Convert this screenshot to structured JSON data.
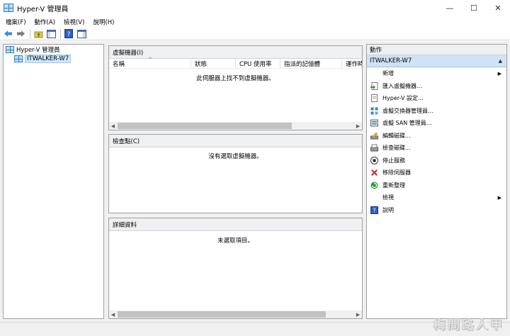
{
  "window": {
    "title": "Hyper-V 管理員",
    "minimize": "—",
    "maximize": "☐",
    "close": "✕"
  },
  "menu": [
    "檔案(F)",
    "動作(A)",
    "檢視(V)",
    "說明(H)"
  ],
  "tree": {
    "root": "Hyper-V 管理員",
    "server": "ITWALKER-W7"
  },
  "vm_panel": {
    "title": "虛擬機器(I)",
    "columns": [
      "名稱",
      "狀態",
      "CPU 使用率",
      "指派的記憶體",
      "運作時"
    ],
    "empty_message": "此伺服器上找不到虛擬機器。"
  },
  "checkpoint_panel": {
    "title": "檢查點(C)",
    "empty_message": "沒有選取虛擬機器。"
  },
  "details_panel": {
    "title": "詳細資料",
    "empty_message": "未選取項目。"
  },
  "actions": {
    "header": "動作",
    "section": "ITWALKER-W7",
    "items": [
      {
        "label": "新增",
        "icon": "none",
        "submenu": true
      },
      {
        "label": "匯入虛擬機器...",
        "icon": "import-icon"
      },
      {
        "label": "Hyper-V 設定...",
        "icon": "settings-page-icon"
      },
      {
        "label": "虛擬交換器管理員...",
        "icon": "switch-icon"
      },
      {
        "label": "虛擬 SAN 管理員...",
        "icon": "san-icon"
      },
      {
        "label": "編輯磁碟...",
        "icon": "edit-disk-icon"
      },
      {
        "label": "檢查磁碟...",
        "icon": "inspect-disk-icon"
      },
      {
        "label": "停止服務",
        "icon": "stop-icon"
      },
      {
        "label": "移除伺服器",
        "icon": "remove-icon"
      },
      {
        "label": "重新整理",
        "icon": "refresh-icon"
      },
      {
        "label": "檢視",
        "icon": "none",
        "submenu": true
      },
      {
        "label": "說明",
        "icon": "help-icon"
      }
    ]
  },
  "watermark": "梅問路人甲",
  "colors": {
    "selection": "#cfe3f7",
    "accent": "#2a7fbf"
  }
}
